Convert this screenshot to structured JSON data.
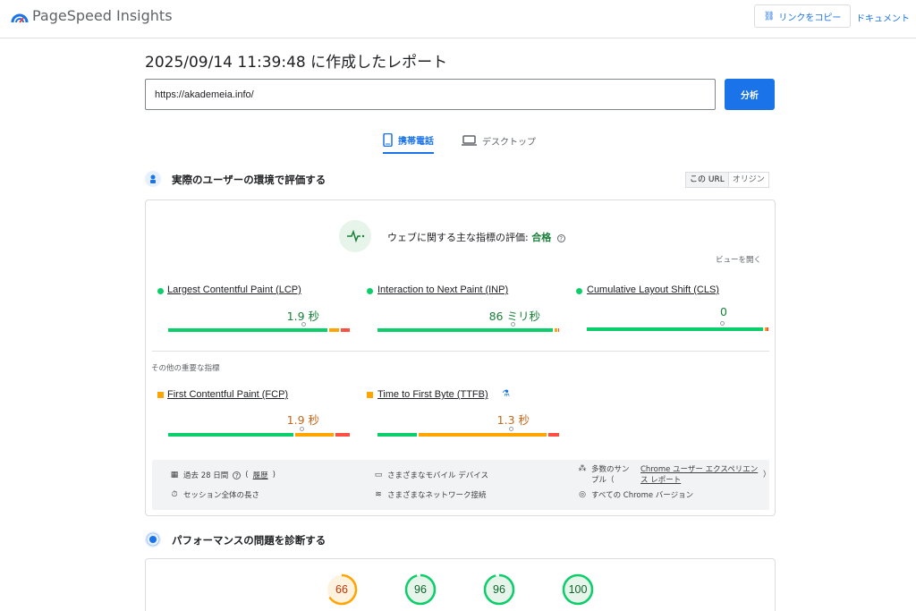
{
  "header": {
    "brand": "PageSpeed Insights",
    "copy_link": "リンクをコピー",
    "docs": "ドキュメント"
  },
  "report": {
    "title": "2025/09/14 11:39:48 に作成したレポート",
    "url_value": "https://akademeia.info/",
    "analyze": "分析"
  },
  "tabs": [
    {
      "label": "携帯電話",
      "icon": "smartphone-icon",
      "active": true
    },
    {
      "label": "デスクトップ",
      "icon": "laptop-icon",
      "active": false
    }
  ],
  "field_section": {
    "heading": "実際のユーザーの環境で評価する",
    "toggle": [
      "この URL",
      "オリジン"
    ],
    "cwv_label": "ウェブに関する主な指標の評価:",
    "cwv_result": "合格",
    "open_view": "ビューを開く",
    "core_metrics": [
      {
        "name": "Largest Contentful Paint (LCP)",
        "value": "1.9 秒",
        "status": "good"
      },
      {
        "name": "Interaction to Next Paint (INP)",
        "value": "86 ミリ秒",
        "status": "good"
      },
      {
        "name": "Cumulative Layout Shift (CLS)",
        "value": "0",
        "status": "good"
      }
    ],
    "other_label": "その他の重要な指標",
    "other_metrics": [
      {
        "name": "First Contentful Paint (FCP)",
        "value": "1.9 秒",
        "status": "average"
      },
      {
        "name": "Time to First Byte (TTFB)",
        "value": "1.3 秒",
        "status": "average",
        "experimental": true
      }
    ],
    "info": {
      "period": "過去 28 日間",
      "history": "履歴",
      "devices": "さまざまなモバイル デバイス",
      "samples_prefix": "多数のサンプル（",
      "samples_link": "Chrome ユーザー エクスペリエンス レポート",
      "samples_suffix": "）",
      "session": "セッション全体の長さ",
      "network": "さまざまなネットワーク接続",
      "chrome": "すべての Chrome バージョン"
    }
  },
  "lab_section": {
    "heading": "パフォーマンスの問題を診断する",
    "scores": [
      66,
      96,
      96,
      100
    ]
  },
  "colors": {
    "accent": "#1a73e8",
    "good": "#0cce6b",
    "average": "#ffa400",
    "poor": "#ff4e42"
  }
}
